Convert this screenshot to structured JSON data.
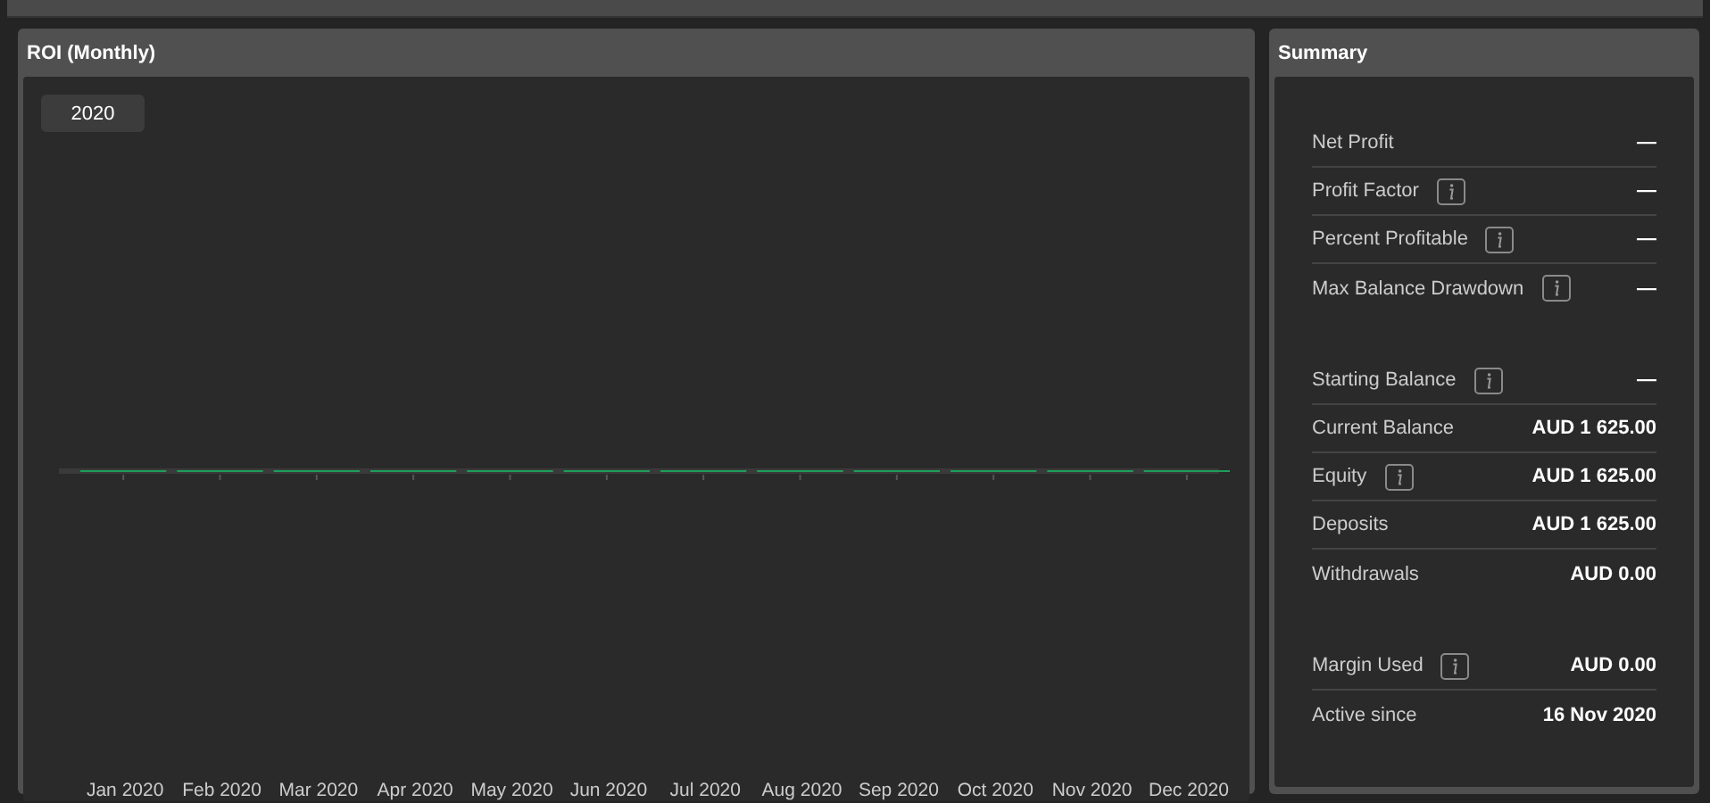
{
  "roi_panel": {
    "title": "ROI (Monthly)",
    "year_tab": {
      "label": "2020",
      "selected": true
    },
    "months": [
      "Jan 2020",
      "Feb 2020",
      "Mar 2020",
      "Apr 2020",
      "May 2020",
      "Jun 2020",
      "Jul 2020",
      "Aug 2020",
      "Sep 2020",
      "Oct 2020",
      "Nov 2020",
      "Dec 2020"
    ]
  },
  "summary": {
    "title": "Summary",
    "groups": [
      [
        {
          "label": "Net Profit",
          "info": false,
          "value": "—"
        },
        {
          "label": "Profit Factor",
          "info": true,
          "value": "—"
        },
        {
          "label": "Percent Profitable",
          "info": true,
          "value": "—"
        },
        {
          "label": "Max Balance Drawdown",
          "info": true,
          "value": "—"
        }
      ],
      [
        {
          "label": "Starting Balance",
          "info": true,
          "value": "—"
        },
        {
          "label": "Current Balance",
          "info": false,
          "value": "AUD 1 625.00"
        },
        {
          "label": "Equity",
          "info": true,
          "value": "AUD 1 625.00"
        },
        {
          "label": "Deposits",
          "info": false,
          "value": "AUD 1 625.00"
        },
        {
          "label": "Withdrawals",
          "info": false,
          "value": "AUD 0.00"
        }
      ],
      [
        {
          "label": "Margin Used",
          "info": true,
          "value": "AUD 0.00"
        },
        {
          "label": "Active since",
          "info": false,
          "value": "16 Nov 2020"
        }
      ]
    ]
  }
}
